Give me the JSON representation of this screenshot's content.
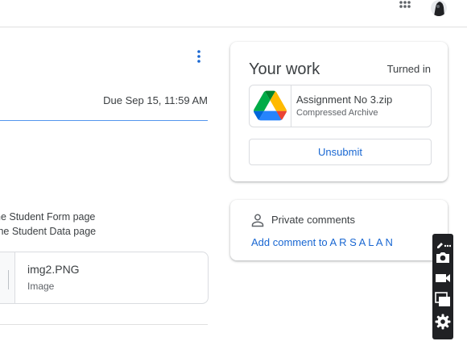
{
  "header": {
    "apps_icon": "apps-grid-icon",
    "avatar": "user-avatar"
  },
  "assignment": {
    "more_icon": "more-vert-icon",
    "due": "Due Sep 15, 11:59 AM",
    "description": [
      "he Student Form page",
      "the Student Data page"
    ],
    "attachment": {
      "name": "img2.PNG",
      "type": "Image"
    }
  },
  "your_work": {
    "title": "Your work",
    "status": "Turned in",
    "file": {
      "name": "Assignment No 3.zip",
      "type": "Compressed Archive",
      "icon": "google-drive-icon"
    },
    "unsubmit_label": "Unsubmit"
  },
  "private_comments": {
    "icon": "person-icon",
    "title": "Private comments",
    "add_label": "Add comment to A R S A L A N"
  },
  "capture_toolbar": {
    "items": [
      "edit-icon",
      "more-horiz-icon",
      "camera-icon",
      "video-camera-icon",
      "windows-icon",
      "settings-gear-icon"
    ]
  },
  "colors": {
    "accent": "#1a73e8",
    "link": "#1967d2",
    "text": "#3c4043",
    "toolbar_bg": "#202124"
  }
}
